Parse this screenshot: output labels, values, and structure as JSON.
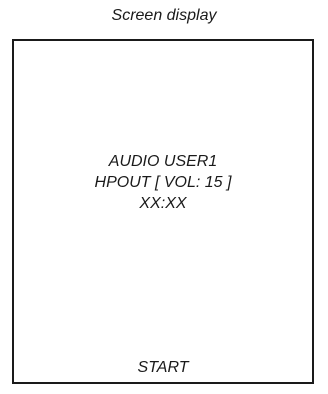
{
  "caption": "Screen display",
  "screen": {
    "lines": [
      "AUDIO USER1",
      "HPOUT [ VOL: 15 ]",
      "XX:XX"
    ],
    "footer": "START"
  }
}
